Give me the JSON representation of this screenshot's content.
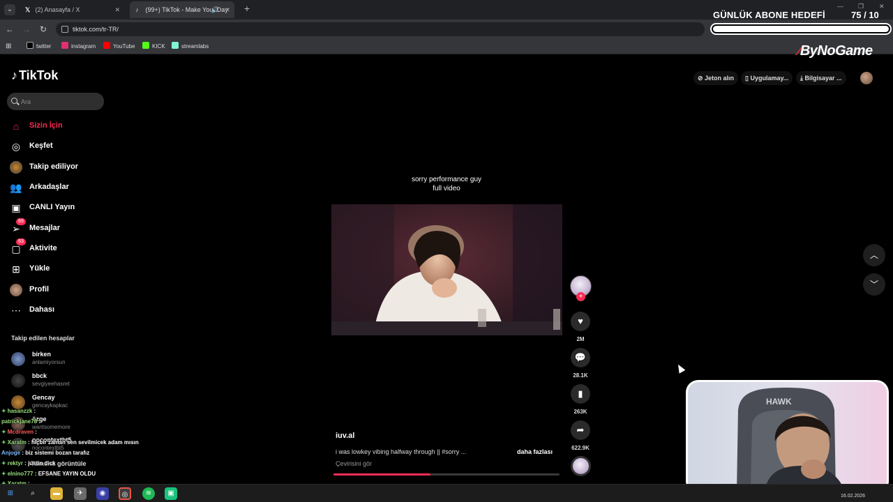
{
  "browser": {
    "tabs": [
      {
        "label": "(2) Anasayfa / X",
        "favicon": "x-icon",
        "active": false
      },
      {
        "label": "(99+) TikTok - Make Your Day",
        "favicon": "tiktok-icon",
        "active": true
      }
    ],
    "new_tab": "+",
    "url": "tiktok.com/tr-TR/",
    "bookmarks": [
      {
        "label": "twitter",
        "icon": "x-icon",
        "color": "#ffffff"
      },
      {
        "label": "instagram",
        "icon": "instagram-icon",
        "color": "#e1306c"
      },
      {
        "label": "YouTube",
        "icon": "youtube-icon",
        "color": "#ff0000"
      },
      {
        "label": "KICK",
        "icon": "kick-icon",
        "color": "#53fc18"
      },
      {
        "label": "streamlabs",
        "icon": "streamlabs-icon",
        "color": "#80f5d2"
      }
    ]
  },
  "overlay": {
    "goal_title": "GÜNLÜK ABONE HEDEFİ",
    "goal_count": "75 / 10",
    "goal_progress": 1.0,
    "brand": "ByNoGame"
  },
  "tiktok": {
    "logo": "TikTok",
    "search_placeholder": "Ara",
    "nav": [
      {
        "label": "Sizin İçin",
        "icon": "home-icon",
        "active": true
      },
      {
        "label": "Keşfet",
        "icon": "compass-icon"
      },
      {
        "label": "Takip ediliyor",
        "icon": "following-avatar-icon"
      },
      {
        "label": "Arkadaşlar",
        "icon": "friends-icon"
      },
      {
        "label": "CANLI Yayın",
        "icon": "live-tv-icon"
      },
      {
        "label": "Mesajlar",
        "icon": "message-icon",
        "badge": "69"
      },
      {
        "label": "Aktivite",
        "icon": "activity-icon",
        "badge": "63"
      },
      {
        "label": "Yükle",
        "icon": "upload-icon"
      },
      {
        "label": "Profil",
        "icon": "profile-avatar-icon"
      },
      {
        "label": "Dahası",
        "icon": "more-icon"
      }
    ],
    "following_title": "Takip edilen hesaplar",
    "following": [
      {
        "name": "birken",
        "handle": "anlamiyorsun"
      },
      {
        "name": "bbck",
        "handle": "sevgiyeehasret"
      },
      {
        "name": "Gencay",
        "handle": "gencaykapkac"
      },
      {
        "name": "özge",
        "handle": "wantsomemore"
      },
      {
        "name": "nocontextbt5",
        "handle": "nocontextbt5"
      }
    ],
    "show_all": "Tümünü görüntüle",
    "top_actions": {
      "coins": "Jeton alın",
      "app": "Uygulamay...",
      "desktop": "Bilgisayar ..."
    },
    "video": {
      "caption_line1": "sorry performance guy",
      "caption_line2": "full video",
      "creator": "iuv.al",
      "description": "i was lowkey vibing halfway through || #sorry ...",
      "more": "daha fazlası",
      "translate": "Çevirisini gör",
      "progress": 0.43,
      "likes": "2M",
      "comments": "28.1K",
      "saves": "263K",
      "shares": "622.9K"
    }
  },
  "chat": [
    {
      "user": "hasanzzk",
      "text": " : ",
      "color": "green"
    },
    {
      "user": "patrickjane78",
      "text": " : ",
      "color": "green"
    },
    {
      "user": "Mcdraven",
      "text": " : ",
      "color": "red"
    },
    {
      "user": "Xaratm",
      "text": " : hiçbir zaman sen sevilmicek adam mısın",
      "color": "green"
    },
    {
      "user": "Anjoge",
      "text": " : biz sistemi bozan tarafız",
      "color": "blue"
    },
    {
      "user": "rektyr",
      "text": " : justin dick",
      "color": "green"
    },
    {
      "user": "elnino777",
      "text": " : EFSANE YAYIN OLDU",
      "color": "green"
    },
    {
      "user": "Xaratm",
      "text": " : ",
      "color": "green"
    }
  ],
  "taskbar": {
    "date": "16.02.2026"
  }
}
